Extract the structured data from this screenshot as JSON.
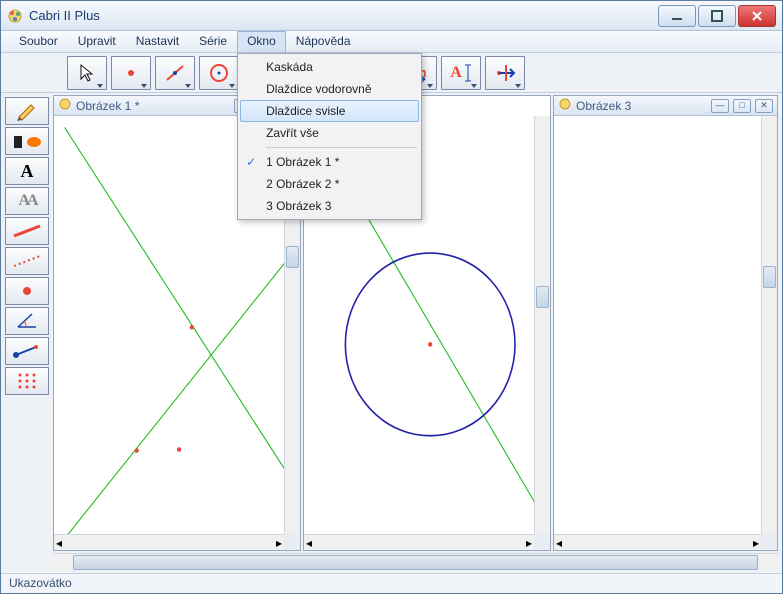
{
  "window": {
    "title": "Cabri II Plus"
  },
  "menu": {
    "items": [
      "Soubor",
      "Upravit",
      "Nastavit",
      "Série",
      "Okno",
      "Nápověda"
    ],
    "open_index": 4,
    "dropdown": {
      "cascade": "Kaskáda",
      "tile_h": "Dlaždice vodorovně",
      "tile_v": "Dlaždice svisle",
      "close_all": "Zavřít vše",
      "win1": "1 Obrázek 1 *",
      "win2": "2 Obrázek 2 *",
      "win3": "3 Obrázek 3"
    }
  },
  "toolbar": {
    "pointer": "pointer",
    "point": "point",
    "line": "line",
    "circle": "circle",
    "measure": "cm",
    "text": "A",
    "transform": "transform"
  },
  "docs": {
    "d1": {
      "title": "Obrázek 1 *"
    },
    "d3": {
      "title": "Obrázek 3"
    }
  },
  "status": {
    "text": "Ukazovátko"
  }
}
